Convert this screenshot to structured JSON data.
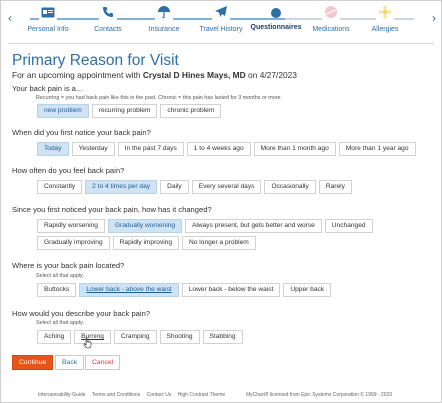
{
  "stepper": {
    "steps": [
      {
        "label": "Personal Info",
        "icon": "id-card-icon",
        "state": "done"
      },
      {
        "label": "Contacts",
        "icon": "phone-icon",
        "state": "done"
      },
      {
        "label": "Insurance",
        "icon": "umbrella-icon",
        "state": "done"
      },
      {
        "label": "Travel History",
        "icon": "airplane-icon",
        "state": "done"
      },
      {
        "label": "Questionnaires",
        "icon": "current-step-dot",
        "state": "current"
      },
      {
        "label": "Medications",
        "icon": "pill-icon",
        "state": "future"
      },
      {
        "label": "Allergies",
        "icon": "allergy-icon",
        "state": "future"
      }
    ]
  },
  "page": {
    "title": "Primary Reason for Visit",
    "subtitle_prefix": "For an upcoming appointment with ",
    "provider": "Crystal D Hines Mays, MD",
    "subtitle_mid": " on ",
    "date": "4/27/2023"
  },
  "questions": {
    "q1": {
      "text": "Your back pain is a...",
      "hint": "Recurring = you had back pain like this in the past. Chronic = this pain has lasted for 3 months or more.",
      "options": [
        "new problem",
        "recurring problem",
        "chronic problem"
      ],
      "selected": "new problem"
    },
    "q2": {
      "text": "When did you first notice your back pain?",
      "options": [
        "Today",
        "Yesterday",
        "In the past 7 days",
        "1 to 4 weeks ago",
        "More than 1 month ago",
        "More than 1 year ago"
      ],
      "selected": "Today"
    },
    "q3": {
      "text": "How often do you feel back pain?",
      "options": [
        "Constantly",
        "2 to 4 times per day",
        "Daily",
        "Every several days",
        "Occasionally",
        "Rarely"
      ],
      "selected": "2 to 4 times per day"
    },
    "q4": {
      "text": "Since you first noticed your back pain, how has it changed?",
      "options": [
        "Rapidly worsening",
        "Gradually worsening",
        "Always present, but gets better and worse",
        "Unchanged",
        "Gradually improving",
        "Rapidly improving",
        "No longer a problem"
      ],
      "selected": "Gradually worsening"
    },
    "q5": {
      "text": "Where is your back pain located?",
      "hint": "Select all that apply.",
      "options": [
        "Buttocks",
        "Lower back - above the waist",
        "Lower back - below the waist",
        "Upper back"
      ],
      "selected": "Lower back - above the waist"
    },
    "q6": {
      "text": "How would you describe your back pain?",
      "hint": "Select all that apply.",
      "options": [
        "Aching",
        "Burning",
        "Cramping",
        "Shooting",
        "Stabbing"
      ],
      "selected": ""
    }
  },
  "actions": {
    "continue": "Continue",
    "back": "Back",
    "cancel": "Cancel"
  },
  "footer": {
    "links": [
      "Interoperability Guide",
      "Terms and Conditions",
      "Contact Us",
      "High Contrast Theme"
    ],
    "copyright": "MyChart® licensed from Epic Systems Corporation © 1999 - 2023"
  },
  "colors": {
    "accent": "#2f6fa8",
    "selected_bg": "#cfe3f4",
    "continue_bg": "#e5541b",
    "cancel_text": "#c43c3c"
  }
}
